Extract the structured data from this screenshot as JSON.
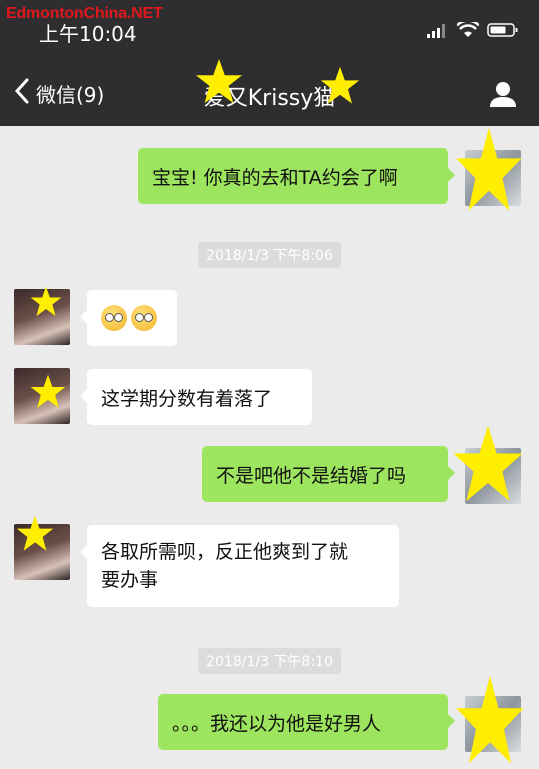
{
  "watermark": "EdmontonChina.NET",
  "status_bar": {
    "time": "上午10:04"
  },
  "nav": {
    "back_label": "微信(9)",
    "title": "爱又Krissy猫"
  },
  "messages": [
    {
      "type": "outgoing",
      "text": "宝宝! 你真的去和TA约会了啊"
    },
    {
      "type": "timestamp",
      "text": "2018/1/3 下午8:06"
    },
    {
      "type": "incoming",
      "text": "",
      "emoji": [
        "dizzy-face",
        "dizzy-face"
      ]
    },
    {
      "type": "incoming",
      "text": "这学期分数有着落了"
    },
    {
      "type": "outgoing",
      "text": "不是吧他不是结婚了吗"
    },
    {
      "type": "incoming",
      "lines": [
        "各取所需呗，反正他爽到了就",
        "要办事"
      ]
    },
    {
      "type": "timestamp",
      "text": "2018/1/3 下午8:10"
    },
    {
      "type": "outgoing",
      "text": "。。。我还以为他是好男人"
    }
  ],
  "colors": {
    "header": "#2e2e30",
    "chat_bg": "#ebebeb",
    "outgoing_bubble": "#9de55f",
    "incoming_bubble": "#ffffff",
    "watermark": "#e0171b",
    "redaction_star": "#ffee00"
  }
}
